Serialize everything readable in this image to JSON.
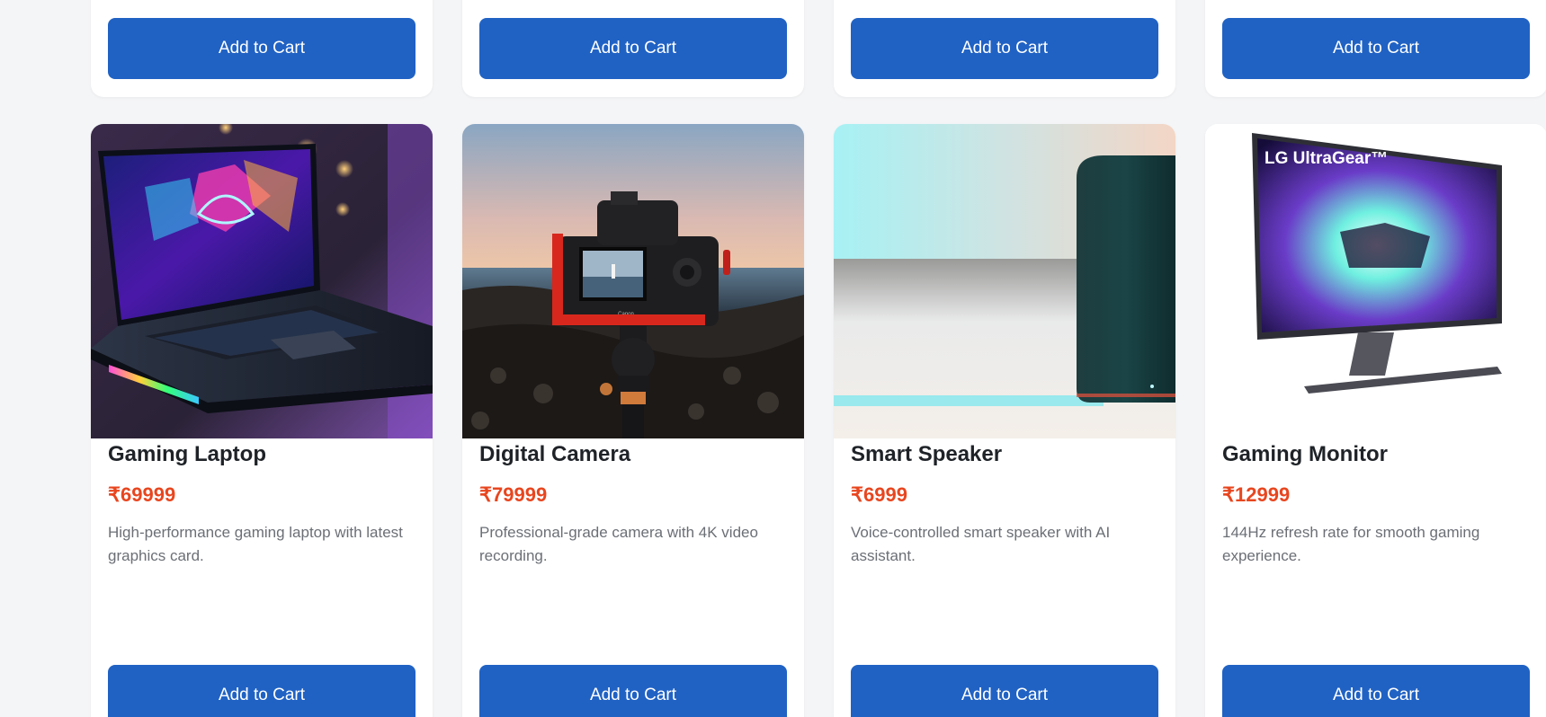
{
  "top_row": [
    {
      "button_label": "Add to Cart"
    },
    {
      "button_label": "Add to Cart"
    },
    {
      "button_label": "Add to Cart"
    },
    {
      "button_label": "Add to Cart"
    }
  ],
  "products": [
    {
      "name": "Gaming Laptop",
      "price": "₹69999",
      "description": "High-performance gaming laptop with latest graphics card.",
      "button_label": "Add to Cart"
    },
    {
      "name": "Digital Camera",
      "price": "₹79999",
      "description": "Professional-grade camera with 4K video recording.",
      "button_label": "Add to Cart"
    },
    {
      "name": "Smart Speaker",
      "price": "₹6999",
      "description": "Voice-controlled smart speaker with AI assistant.",
      "button_label": "Add to Cart"
    },
    {
      "name": "Gaming Monitor",
      "price": "₹12999",
      "description": "144Hz refresh rate for smooth gaming experience.",
      "button_label": "Add to Cart",
      "image_logo_text": "LG UltraGear™"
    }
  ],
  "colors": {
    "page_background": "#f4f5f7",
    "card_background": "#ffffff",
    "button": "#2062c4",
    "price": "#e8461f",
    "title": "#1f2328",
    "description": "#6b6f76"
  }
}
